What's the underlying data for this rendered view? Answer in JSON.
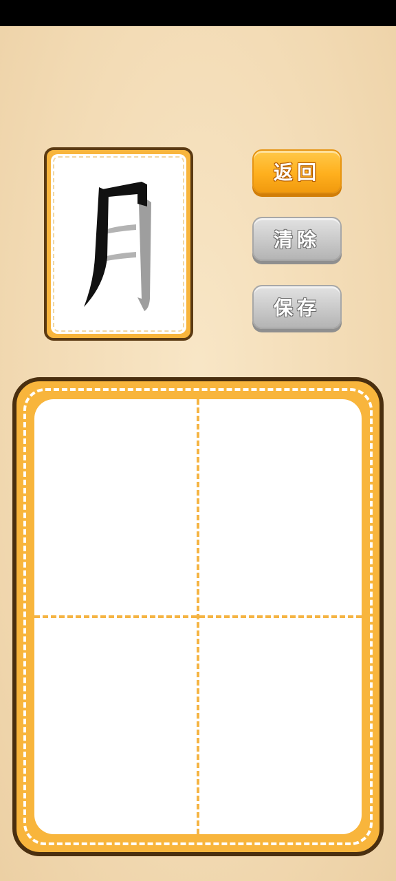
{
  "status_bar": {},
  "preview": {
    "character": "月",
    "icon": "character-stroke-preview"
  },
  "buttons": {
    "back_label": "返回",
    "clear_label": "清除",
    "save_label": "保存"
  },
  "board": {
    "grid": "tian-zi-ge"
  },
  "colors": {
    "accent_orange": "#f8b53c",
    "border_brown": "#4a2f0f",
    "button_gray": "#c9c9c9",
    "background": "#f3dfba"
  }
}
